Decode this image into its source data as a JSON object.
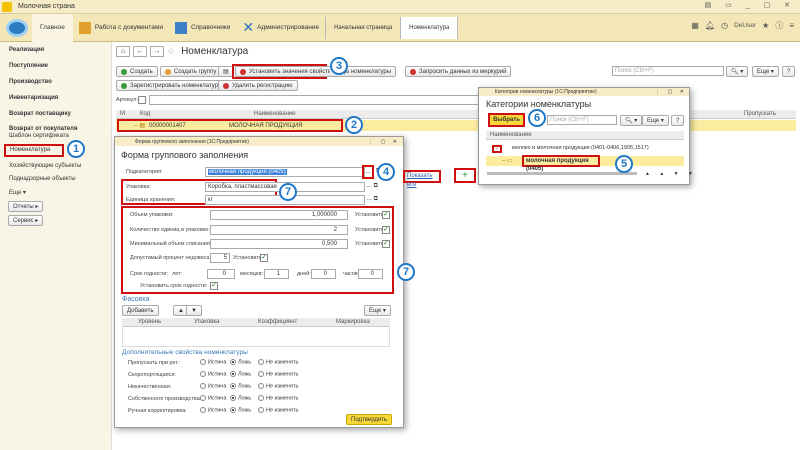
{
  "app": {
    "title": "Молочная страна",
    "user": "DeUser"
  },
  "sections": {
    "home": "Главное",
    "docs": "Работа с документами",
    "refs": "Справочники",
    "admin": "Администрирование"
  },
  "tabs": {
    "start": "Начальная страница",
    "nom": "Номенклатура"
  },
  "sidebar": {
    "items": [
      "Реализация",
      "Поступление",
      "Производство",
      "Инвентаризация",
      "Возврат поставщику",
      "Возврат от покупателя",
      "Шаблон сертификата",
      "Номенклатура",
      "Хозяйствующие субъекты",
      "Поднадзорные объекты",
      "Еще ▾"
    ],
    "reports": "Отчеты",
    "service": "Сервис"
  },
  "main": {
    "title": "Номенклатура",
    "btn_create": "Создать",
    "btn_group": "Создать группу",
    "btn_set": "Установить значения свойств",
    "btn_type": "Виды номенклатуры",
    "btn_mercury": "Запросить данных из меркурий",
    "btn_register": "Зарегистрировать номенклатуру",
    "btn_unreg": "Удалить регистрацию",
    "search_ph": "Поиск (Ctrl+F)",
    "more": "Еще",
    "article": "Артикул:",
    "col_m": "М",
    "col_code": "Код",
    "col_name": "Наименование",
    "col_skip": "Пропускать",
    "row_code": "00000001407",
    "row_name": "МОЛОЧНАЯ ПРОДУКЦИЯ",
    "show_all": "Показать все"
  },
  "form": {
    "window_title": "Форма группового заполнения  (1С:Предприятие)",
    "title": "Форма группового заполнения",
    "subcat_lbl": "Подкатегория:",
    "subcat_val": "молочная продукция (0405)",
    "pack_lbl": "Упаковка:",
    "pack_val": "Коробка, пластмассовая",
    "unit_lbl": "Единица хранения:",
    "unit_val": "кг",
    "vol_lbl": "Объем упаковки:",
    "vol_val": "1,000000",
    "qty_lbl": "Количество единиц в упаковке:",
    "qty_val": "2",
    "min_lbl": "Минимальный объем списания:",
    "min_val": "0,500",
    "pct_lbl": "Допустимый процент недовеса:",
    "pct_val": "5",
    "set": "Установить",
    "shelf_lbl": "Срок годности:",
    "years": "лет:",
    "months": "месяцев:",
    "days": "дней:",
    "hours": "часов:",
    "years_v": "0",
    "months_v": "1",
    "days_v": "0",
    "hours_v": "0",
    "set_shelf": "Установить срок годности:",
    "pack_section": "Фасовка",
    "add": "Добавить",
    "more": "Еще",
    "cols": [
      "Уровень",
      "Упаковка",
      "Коэффициент",
      "Маркировка"
    ],
    "props_title": "Дополнительные свойства номенклатуры",
    "props": [
      "Пропускать при рег.:",
      "Скоропортящаяся:",
      "Некачественная:",
      "Собственного производства:",
      "Ручная корректировка:"
    ],
    "opt_true": "Истина",
    "opt_false": "Ложь",
    "opt_keep": "Не изменять",
    "confirm": "Подтвердить"
  },
  "popup": {
    "window_title": "Категории номенклатуры  (1С:Предприятие)",
    "title": "Категории номенклатуры",
    "select": "Выбрать",
    "search_ph": "Поиск (Ctrl+F)",
    "more": "Еще",
    "col": "Наименование",
    "parent": "молоко и молочная продукция (0401-0406,1905,1517)",
    "child": "молочная продукция (0405)"
  },
  "markers": [
    "1",
    "2",
    "3",
    "4",
    "5",
    "6",
    "7",
    "7"
  ]
}
